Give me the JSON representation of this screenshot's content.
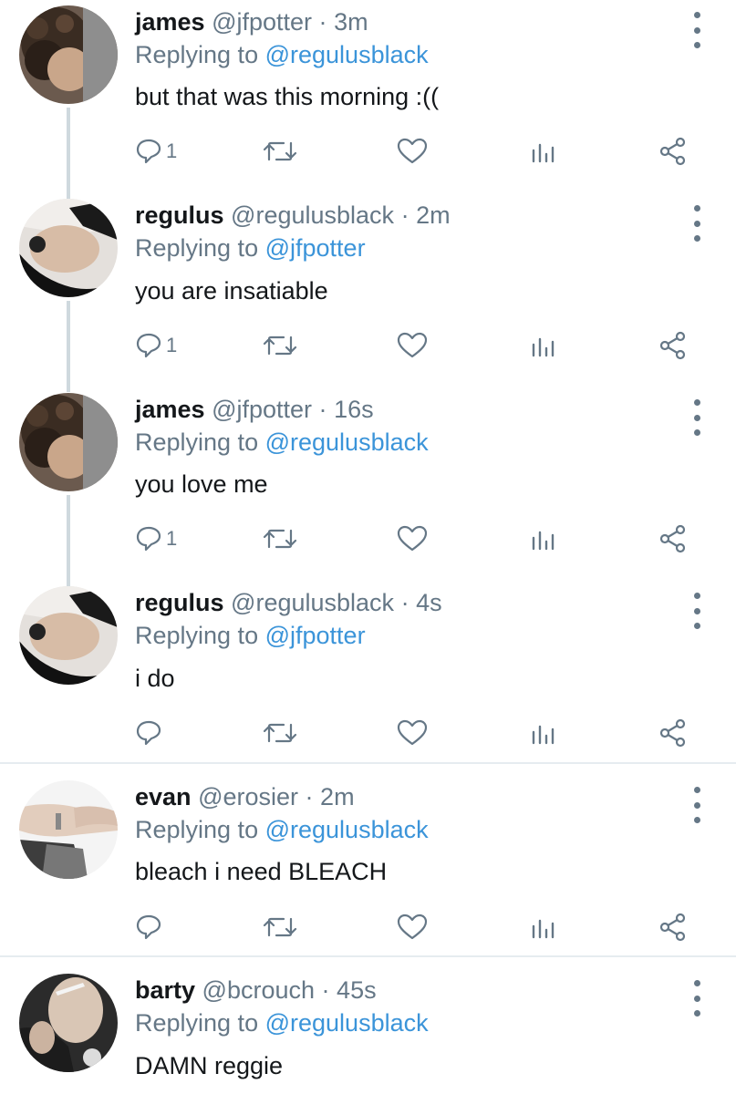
{
  "tweets": [
    {
      "name": "james",
      "handle": "@jfpotter",
      "time": "3m",
      "replying_prefix": "Replying to",
      "replying_to": "@regulusblack",
      "text": "but that was this morning :((",
      "reply_count": "1",
      "avatar": "curly-hair-avatar"
    },
    {
      "name": "regulus",
      "handle": "@regulusblack",
      "time": "2m",
      "replying_prefix": "Replying to",
      "replying_to": "@jfpotter",
      "text": "you are insatiable",
      "reply_count": "1",
      "avatar": "dark-hair-avatar"
    },
    {
      "name": "james",
      "handle": "@jfpotter",
      "time": "16s",
      "replying_prefix": "Replying to",
      "replying_to": "@regulusblack",
      "text": "you love me",
      "reply_count": "1",
      "avatar": "curly-hair-avatar"
    },
    {
      "name": "regulus",
      "handle": "@regulusblack",
      "time": "4s",
      "replying_prefix": "Replying to",
      "replying_to": "@jfpotter",
      "text": "i do",
      "reply_count": "",
      "avatar": "dark-hair-avatar"
    },
    {
      "name": "evan",
      "handle": "@erosier",
      "time": "2m",
      "replying_prefix": "Replying to",
      "replying_to": "@regulusblack",
      "text": "bleach i need BLEACH",
      "reply_count": "",
      "avatar": "hands-avatar"
    },
    {
      "name": "barty",
      "handle": "@bcrouch",
      "time": "45s",
      "replying_prefix": "Replying to",
      "replying_to": "@regulusblack",
      "text": "DAMN reggie",
      "reply_count": "",
      "avatar": "cigarette-avatar"
    }
  ],
  "meta_separator": "·",
  "colors": {
    "name": "#14171a",
    "muted": "#657786",
    "mention": "#3b94d9",
    "thread_line": "#cfd9de",
    "divider": "#e6ecf0"
  }
}
